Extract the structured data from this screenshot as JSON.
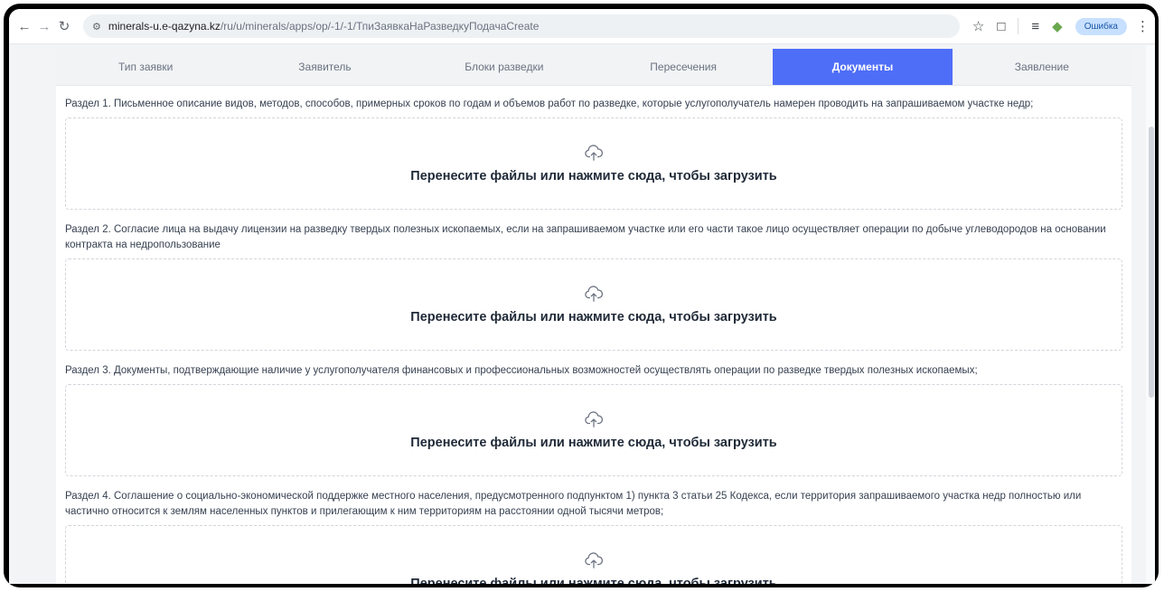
{
  "browser": {
    "back_icon": "arrow-left-icon",
    "forward_icon": "arrow-right-icon",
    "reload_icon": "reload-icon",
    "url_host": "minerals-u.e-qazyna.kz",
    "url_path": "/ru/u/minerals/apps/op/-1/-1/ТпиЗаявкаНаРазведкуПодачаCreate",
    "error_label": "Ошибка"
  },
  "tabs": [
    {
      "label": "Тип заявки"
    },
    {
      "label": "Заявитель"
    },
    {
      "label": "Блоки разведки"
    },
    {
      "label": "Пересечения"
    },
    {
      "label": "Документы",
      "active": true
    },
    {
      "label": "Заявление"
    }
  ],
  "sections": [
    {
      "text": "Раздел 1. Письменное описание видов, методов, способов, примерных сроков по годам и объемов работ по разведке, которые услугополучатель намерен проводить на запрашиваемом участке недр;"
    },
    {
      "text": "Раздел 2. Согласие лица на выдачу лицензии на разведку твердых полезных ископаемых, если на запрашиваемом участке или его части такое лицо осуществляет операции по добыче углеводородов на основании контракта на недропользование"
    },
    {
      "text": "Раздел 3. Документы, подтверждающие наличие у услугополучателя финансовых и профессиональных возможностей осуществлять операции по разведке твердых полезных ископаемых;"
    },
    {
      "text": "Раздел 4. Соглашение о социально-экономической поддержке местного населения, предусмотренного подпунктом 1) пункта 3 статьи 25 Кодекса, если территория запрашиваемого участка недр полностью или частично относится к землям населенных пунктов и прилегающим к ним территориям на расстоянии одной тысячи метров;"
    }
  ],
  "dropzone": {
    "label": "Перенесите файлы или нажмите сюда, чтобы загрузить",
    "icon": "cloud-upload-icon"
  },
  "colors": {
    "accent": "#4f6ef7",
    "tab_bg": "#f1f3f5",
    "error_pill": "#c7e0ff"
  }
}
